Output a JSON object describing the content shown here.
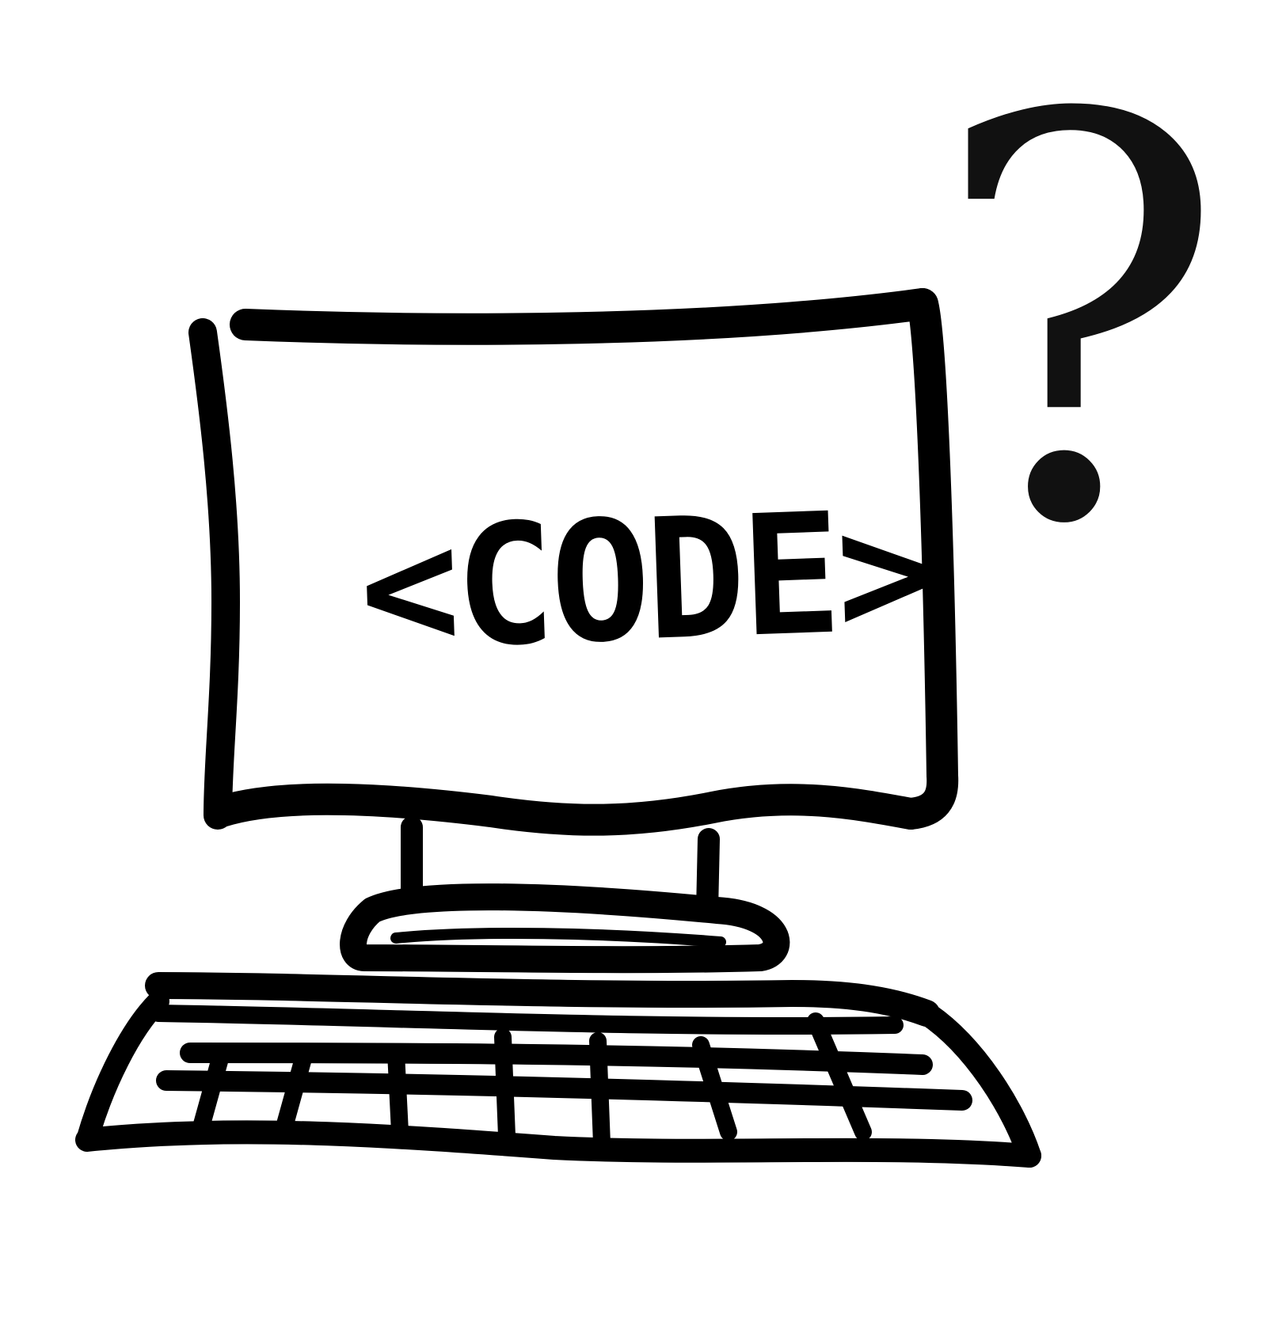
{
  "illustration": {
    "screen_text": "<CODE>",
    "question_mark": "?",
    "ink_color": "#000000",
    "background_color": "#ffffff"
  },
  "icons": {
    "computer": "computer-icon",
    "keyboard": "keyboard-icon",
    "question": "question-mark-icon"
  }
}
